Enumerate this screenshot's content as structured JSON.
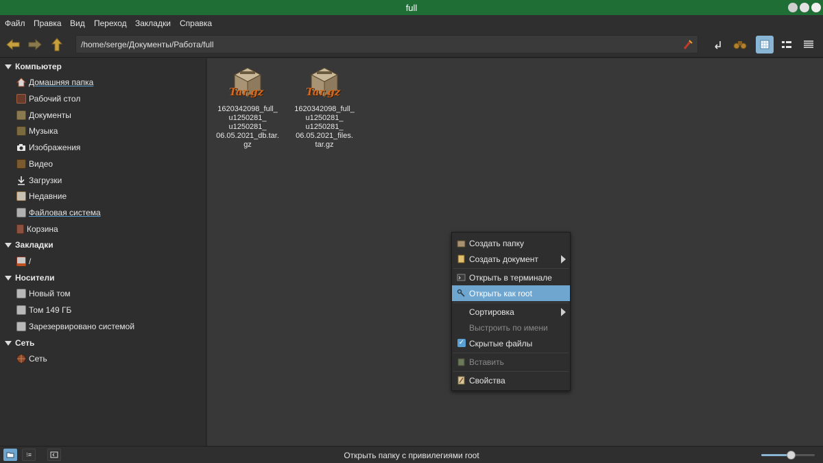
{
  "window": {
    "title": "full"
  },
  "menubar": {
    "items": [
      "Файл",
      "Правка",
      "Вид",
      "Переход",
      "Закладки",
      "Справка"
    ]
  },
  "toolbar": {
    "path": "/home/serge/Документы/Работа/full",
    "view_mode": "icons"
  },
  "sidebar": {
    "sections": [
      {
        "label": "Компьютер",
        "items": [
          {
            "label": "Домашняя папка",
            "icon": "home-icon",
            "underline": true
          },
          {
            "label": "Рабочий стол",
            "icon": "desktop-icon"
          },
          {
            "label": "Документы",
            "icon": "documents-icon"
          },
          {
            "label": "Музыка",
            "icon": "music-icon"
          },
          {
            "label": "Изображения",
            "icon": "camera-icon"
          },
          {
            "label": "Видео",
            "icon": "video-icon"
          },
          {
            "label": "Загрузки",
            "icon": "download-icon"
          },
          {
            "label": "Недавние",
            "icon": "recent-icon"
          },
          {
            "label": "Файловая система",
            "icon": "filesystem-icon",
            "underline": true
          },
          {
            "label": "Корзина",
            "icon": "trash-icon"
          }
        ]
      },
      {
        "label": "Закладки",
        "items": [
          {
            "label": "/",
            "icon": "bookmark-folder-icon"
          }
        ]
      },
      {
        "label": "Носители",
        "items": [
          {
            "label": "Новый том",
            "icon": "drive-icon"
          },
          {
            "label": "Том 149 ГБ",
            "icon": "drive-icon"
          },
          {
            "label": "Зарезервировано системой",
            "icon": "drive-icon"
          }
        ]
      },
      {
        "label": "Сеть",
        "items": [
          {
            "label": "Сеть",
            "icon": "network-icon"
          }
        ]
      }
    ]
  },
  "files": [
    {
      "name_lines": [
        "1620342098_full_",
        "u1250281_",
        "u1250281_",
        "06.05.2021_db.tar.",
        "gz"
      ],
      "icon": "archive-tar-gz-icon",
      "badge": "Tar.gz"
    },
    {
      "name_lines": [
        "1620342098_full_",
        "u1250281_",
        "u1250281_",
        "06.05.2021_files.",
        "tar.gz"
      ],
      "icon": "archive-tar-gz-icon",
      "badge": "Tar.gz"
    }
  ],
  "context_menu": {
    "items": [
      {
        "label": "Создать папку",
        "icon": "folder-new-icon"
      },
      {
        "label": "Создать документ",
        "icon": "document-new-icon",
        "submenu": true
      },
      {
        "label": "Открыть в терминале",
        "icon": "terminal-icon"
      },
      {
        "label": "Открыть как root",
        "icon": "root-key-icon",
        "highlighted": true
      },
      {
        "label": "Сортировка",
        "submenu": true
      },
      {
        "label": "Выстроить по имени",
        "disabled": true
      },
      {
        "label": "Скрытые файлы",
        "checked": true
      },
      {
        "label": "Вставить",
        "icon": "paste-icon",
        "disabled": true
      },
      {
        "label": "Свойства",
        "icon": "properties-icon"
      }
    ]
  },
  "statusbar": {
    "text": "Открыть папку с привилегиями root",
    "zoom_fraction": 0.55
  },
  "colors": {
    "titlebar": "#1f6e36",
    "highlight": "#6ea6cf",
    "accent": "#5a9fd4"
  }
}
